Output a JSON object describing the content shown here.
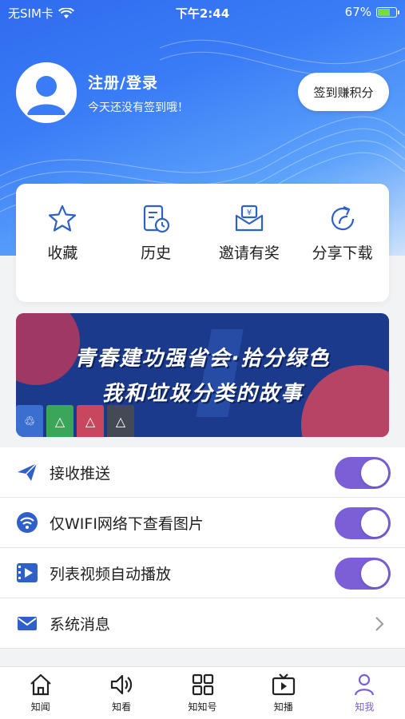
{
  "status_bar": {
    "carrier": "无SIM卡",
    "time": "下午2:44",
    "battery_percent": "67%",
    "battery_level": 0.67
  },
  "profile": {
    "login_label": "注册/登录",
    "checkin_hint": "今天还没有签到哦！",
    "checkin_button": "签到赚积分"
  },
  "quick_actions": [
    {
      "label": "收藏",
      "icon": "star-icon"
    },
    {
      "label": "历史",
      "icon": "history-icon"
    },
    {
      "label": "邀请有奖",
      "icon": "gift-envelope-icon"
    },
    {
      "label": "分享下载",
      "icon": "share-icon"
    }
  ],
  "banner": {
    "line1": "青春建功强省会·拾分绿色",
    "line2": "我和垃圾分类的故事",
    "bins": [
      {
        "symbol": "♲",
        "color": "#3a6fcf"
      },
      {
        "symbol": "△",
        "color": "#3aa65a"
      },
      {
        "symbol": "△",
        "color": "#c9465f"
      },
      {
        "symbol": "△",
        "color": "#444a55"
      }
    ]
  },
  "settings": [
    {
      "label": "接收推送",
      "icon": "paper-plane-icon",
      "toggle": true
    },
    {
      "label": "仅WIFI网络下查看图片",
      "icon": "wifi-icon",
      "toggle": true
    },
    {
      "label": "列表视频自动播放",
      "icon": "video-play-icon",
      "toggle": true
    },
    {
      "label": "系统消息",
      "icon": "mail-icon",
      "toggle": false
    }
  ],
  "tabs": [
    {
      "label": "知闻",
      "icon": "home-icon",
      "active": false
    },
    {
      "label": "知看",
      "icon": "speaker-icon",
      "active": false
    },
    {
      "label": "知知号",
      "icon": "grid-icon",
      "active": false
    },
    {
      "label": "知播",
      "icon": "tv-play-icon",
      "active": false
    },
    {
      "label": "知我",
      "icon": "person-icon",
      "active": true
    }
  ],
  "colors": {
    "accent": "#7a5fd6",
    "brand_blue": "#2f6bef",
    "icon_blue": "#2f5fc9"
  }
}
